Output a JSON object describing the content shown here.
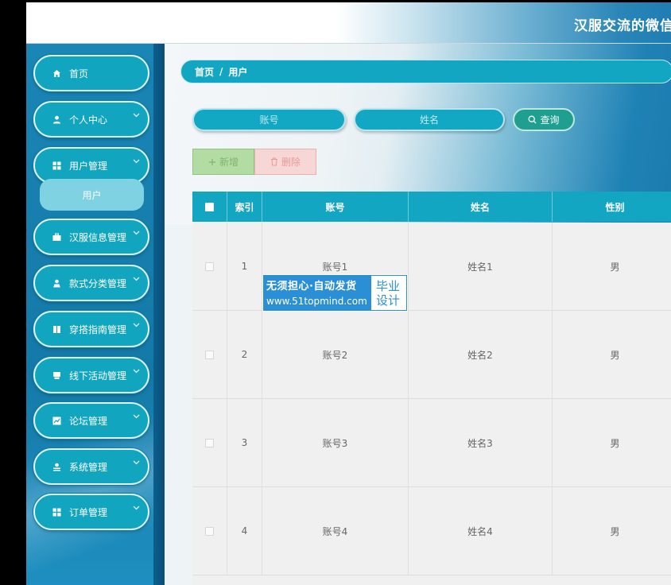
{
  "header": {
    "title": "汉服交流的微信"
  },
  "sidebar": {
    "items": [
      {
        "label": "首页",
        "icon": "home-icon",
        "has_chevron": false
      },
      {
        "label": "个人中心",
        "icon": "user-icon",
        "has_chevron": true
      },
      {
        "label": "用户管理",
        "icon": "grid-icon",
        "has_chevron": true
      },
      {
        "label": "汉服信息管理",
        "icon": "briefcase-icon",
        "has_chevron": true
      },
      {
        "label": "款式分类管理",
        "icon": "person-icon",
        "has_chevron": true
      },
      {
        "label": "穿搭指南管理",
        "icon": "book-icon",
        "has_chevron": true
      },
      {
        "label": "线下活动管理",
        "icon": "print-icon",
        "has_chevron": true
      },
      {
        "label": "论坛管理",
        "icon": "chart-icon",
        "has_chevron": true
      },
      {
        "label": "系统管理",
        "icon": "user-gear-icon",
        "has_chevron": true
      },
      {
        "label": "订单管理",
        "icon": "grid-icon",
        "has_chevron": true
      }
    ],
    "submenu": {
      "label": "用户"
    }
  },
  "breadcrumb": {
    "home": "首页",
    "separator": "/",
    "current": "用户"
  },
  "search": {
    "account_placeholder": "账号",
    "name_placeholder": "姓名",
    "query_label": "查询"
  },
  "actions": {
    "add_label": "新增",
    "delete_label": "删除"
  },
  "table": {
    "headers": [
      "索引",
      "账号",
      "姓名",
      "性别"
    ],
    "rows": [
      {
        "index": "1",
        "account": "账号1",
        "name": "姓名1",
        "gender": "男"
      },
      {
        "index": "2",
        "account": "账号2",
        "name": "姓名2",
        "gender": "男"
      },
      {
        "index": "3",
        "account": "账号3",
        "name": "姓名3",
        "gender": "男"
      },
      {
        "index": "4",
        "account": "账号4",
        "name": "姓名4",
        "gender": "男"
      }
    ]
  },
  "watermark": {
    "line1": "无须担心·自动发货",
    "line2": "www.51topmind.com",
    "badge_line1": "毕业",
    "badge_line2": "设计"
  },
  "colors": {
    "accent": "#13a6c2",
    "sidebar": "#1479a8",
    "query": "#1e9f90",
    "add": "#b3dba4",
    "delete": "#f7d6d6"
  }
}
